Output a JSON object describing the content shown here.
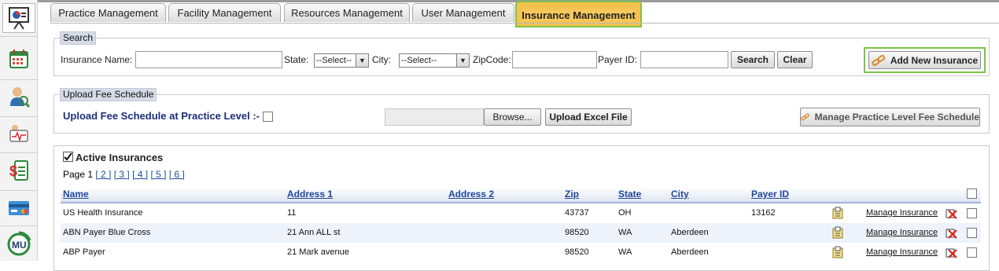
{
  "sidebar": {
    "items": [
      {
        "icon": "presentation-chart-icon"
      },
      {
        "icon": "calendar-icon"
      },
      {
        "icon": "patient-search-icon"
      },
      {
        "icon": "vitals-monitor-icon"
      },
      {
        "icon": "billing-document-icon"
      },
      {
        "icon": "payment-card-icon"
      },
      {
        "icon": "mu-badge-icon",
        "text": "MU"
      }
    ]
  },
  "tabs": [
    {
      "label": "Practice Management"
    },
    {
      "label": "Facility Management"
    },
    {
      "label": "Resources Management"
    },
    {
      "label": "User Management"
    },
    {
      "label": "Insurance Management",
      "active": true
    }
  ],
  "search": {
    "legend": "Search",
    "insurance_name_label": "Insurance Name:",
    "insurance_name_value": "",
    "state_label": "State:",
    "state_selected": "--Select--",
    "city_label": "City:",
    "city_selected": "--Select--",
    "zip_label": "ZipCode:",
    "zip_value": "",
    "payer_label": "Payer ID:",
    "payer_value": "",
    "search_button": "Search",
    "clear_button": "Clear",
    "add_button": "Add New Insurance"
  },
  "upload": {
    "legend": "Upload Fee Schedule",
    "practice_level_label": "Upload Fee Schedule at Practice Level :-",
    "browse_button": "Browse...",
    "upload_button": "Upload Excel File",
    "manage_button": "Manage Practice Level Fee Schedule"
  },
  "list": {
    "active_label": "Active Insurances",
    "page_prefix": "Page 1",
    "pages": [
      "[ 2 ]",
      "[ 3 ]",
      "[ 4 ]",
      "[ 5 ]",
      "[ 6 ]"
    ],
    "columns": {
      "name": "Name",
      "address1": "Address 1",
      "address2": "Address 2",
      "zip": "Zip",
      "state": "State",
      "city": "City",
      "payer": "Payer ID"
    },
    "manage_link": "Manage Insurance",
    "rows": [
      {
        "name": "US Health Insurance",
        "address1": "11",
        "address2": "",
        "zip": "43737",
        "state": "OH",
        "city": "",
        "payer": "13162"
      },
      {
        "name": "ABN Payer Blue Cross",
        "address1": "21 Ann ALL st",
        "address2": "",
        "zip": "98520",
        "state": "WA",
        "city": "Aberdeen",
        "payer": ""
      },
      {
        "name": "ABP Payer",
        "address1": "21 Mark avenue",
        "address2": "",
        "zip": "98520",
        "state": "WA",
        "city": "Aberdeen",
        "payer": ""
      }
    ]
  },
  "colors": {
    "active_tab": "#f6c24f",
    "highlight": "#79c545",
    "link": "#1a4e9b",
    "header_text": "#21479c"
  }
}
